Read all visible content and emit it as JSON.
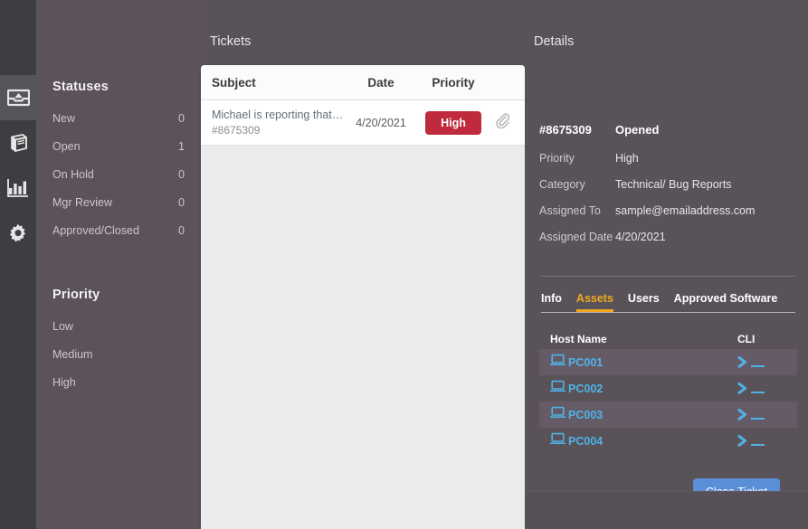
{
  "rail": {
    "items": [
      {
        "name": "inbox-icon",
        "label": "Inbox",
        "active": true
      },
      {
        "name": "book-icon",
        "label": "Knowledge Base",
        "active": false
      },
      {
        "name": "bar-chart-icon",
        "label": "Reports",
        "active": false
      },
      {
        "name": "gear-icon",
        "label": "Settings",
        "active": false
      }
    ]
  },
  "sidebar": {
    "statuses_heading": "Statuses",
    "statuses": [
      {
        "label": "New",
        "count": "0"
      },
      {
        "label": "Open",
        "count": "1"
      },
      {
        "label": "On Hold",
        "count": "0"
      },
      {
        "label": "Mgr Review",
        "count": "0"
      },
      {
        "label": "Approved/Closed",
        "count": "0"
      }
    ],
    "priority_heading": "Priority",
    "priorities": [
      {
        "label": "Low"
      },
      {
        "label": "Medium"
      },
      {
        "label": "High"
      }
    ]
  },
  "tickets": {
    "title": "Tickets",
    "columns": {
      "subject": "Subject",
      "date": "Date",
      "priority": "Priority"
    },
    "clip_icon": "paperclip-icon",
    "rows": [
      {
        "subject": "Michael is reporting that th…",
        "number": "#8675309",
        "date": "4/20/2021",
        "priority": "High",
        "priority_color": "#bf2a3c"
      }
    ]
  },
  "details": {
    "title": "Details",
    "ticket_number": "#8675309",
    "status": "Opened",
    "fields": [
      {
        "key": "Priority",
        "value": "High"
      },
      {
        "key": "Category",
        "value": "Technical/ Bug Reports"
      },
      {
        "key": "Assigned To",
        "value": "sample@emailaddress.com"
      },
      {
        "key": "Assigned Date",
        "value": "4/20/2021"
      }
    ],
    "tabs": [
      {
        "label": "Info",
        "active": false
      },
      {
        "label": "Assets",
        "active": true
      },
      {
        "label": "Users",
        "active": false
      },
      {
        "label": "Approved Software",
        "active": false
      }
    ],
    "tab_accent": "#f0a81e",
    "assets": {
      "columns": {
        "host": "Host Name",
        "cli": "CLI"
      },
      "host_icon": "laptop-icon",
      "cli_icon": "terminal-prompt-icon",
      "accent": "#4fb3e8",
      "rows": [
        {
          "host": "PC001"
        },
        {
          "host": "PC002"
        },
        {
          "host": "PC003"
        },
        {
          "host": "PC004"
        }
      ]
    },
    "close_button": "Close Ticket",
    "close_button_color": "#5a8ed6"
  }
}
